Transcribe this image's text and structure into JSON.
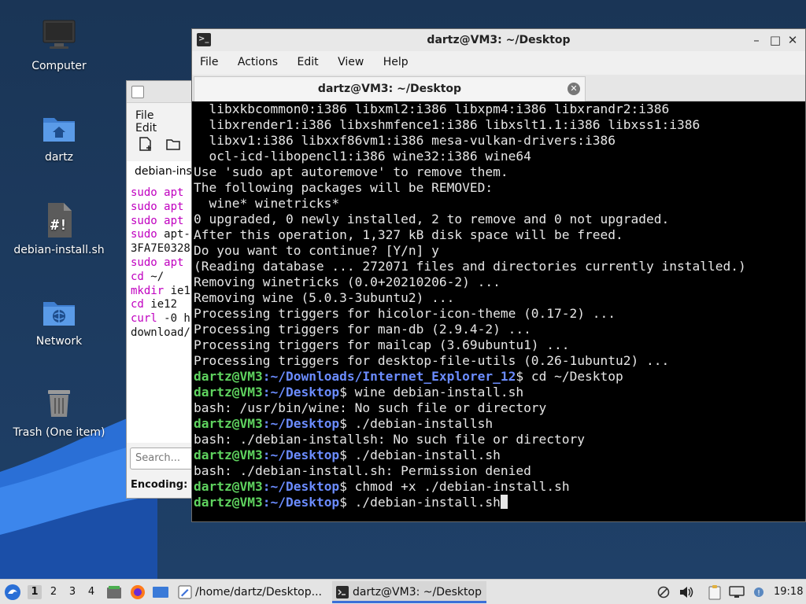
{
  "desktop": {
    "icons": [
      {
        "label": "Computer"
      },
      {
        "label": "dartz"
      },
      {
        "label": "debian-install.sh"
      },
      {
        "label": "Network"
      },
      {
        "label": "Trash (One item)"
      }
    ]
  },
  "editor": {
    "menu": [
      "File",
      "Edit"
    ],
    "tab_label": "debian-install.sh",
    "lines": [
      {
        "kw": "sudo apt",
        "rest": ""
      },
      {
        "kw": "sudo apt",
        "rest": ""
      },
      {
        "kw": "sudo apt",
        "rest": ""
      },
      {
        "kw": "sudo",
        "rest": " apt-"
      },
      {
        "kw": "",
        "rest": "3FA7E0328"
      },
      {
        "kw": "sudo apt",
        "rest": ""
      },
      {
        "kw": "cd",
        "rest": " ~/"
      },
      {
        "kw": "mkdir",
        "rest": " ie1"
      },
      {
        "kw": "cd",
        "rest": " ie12"
      },
      {
        "kw": "curl",
        "rest": " -0 h"
      },
      {
        "kw": "",
        "rest": "download/"
      }
    ],
    "search_placeholder": "Search...",
    "encoding_label": "Encoding:"
  },
  "terminal": {
    "title": "dartz@VM3: ~/Desktop",
    "menu": [
      "File",
      "Actions",
      "Edit",
      "View",
      "Help"
    ],
    "tab_label": "dartz@VM3: ~/Desktop",
    "prompt_user": "dartz@VM3",
    "lines": [
      {
        "text": "  libxkbcommon0:i386 libxml2:i386 libxpm4:i386 libxrandr2:i386"
      },
      {
        "text": "  libxrender1:i386 libxshmfence1:i386 libxslt1.1:i386 libxss1:i386"
      },
      {
        "text": "  libxv1:i386 libxxf86vm1:i386 mesa-vulkan-drivers:i386"
      },
      {
        "text": "  ocl-icd-libopencl1:i386 wine32:i386 wine64"
      },
      {
        "text": "Use 'sudo apt autoremove' to remove them."
      },
      {
        "text": "The following packages will be REMOVED:"
      },
      {
        "text": "  wine* winetricks*"
      },
      {
        "text": "0 upgraded, 0 newly installed, 2 to remove and 0 not upgraded."
      },
      {
        "text": "After this operation, 1,327 kB disk space will be freed."
      },
      {
        "text": "Do you want to continue? [Y/n] y"
      },
      {
        "text": "(Reading database ... 272071 files and directories currently installed.)"
      },
      {
        "text": "Removing winetricks (0.0+20210206-2) ..."
      },
      {
        "text": "Removing wine (5.0.3-3ubuntu2) ..."
      },
      {
        "text": "Processing triggers for hicolor-icon-theme (0.17-2) ..."
      },
      {
        "text": "Processing triggers for man-db (2.9.4-2) ..."
      },
      {
        "text": "Processing triggers for mailcap (3.69ubuntu1) ..."
      },
      {
        "text": "Processing triggers for desktop-file-utils (0.26-1ubuntu2) ..."
      },
      {
        "prompt": true,
        "path": "~/Downloads/Internet_Explorer_12",
        "cmd": " cd ~/Desktop"
      },
      {
        "prompt": true,
        "path": "~/Desktop",
        "cmd": " wine debian-install.sh"
      },
      {
        "text": "bash: /usr/bin/wine: No such file or directory"
      },
      {
        "prompt": true,
        "path": "~/Desktop",
        "cmd": " ./debian-installsh"
      },
      {
        "text": "bash: ./debian-installsh: No such file or directory"
      },
      {
        "prompt": true,
        "path": "~/Desktop",
        "cmd": " ./debian-install.sh"
      },
      {
        "text": "bash: ./debian-install.sh: Permission denied"
      },
      {
        "prompt": true,
        "path": "~/Desktop",
        "cmd": " chmod +x ./debian-install.sh"
      },
      {
        "prompt": true,
        "path": "~/Desktop",
        "cmd": " ./debian-install.sh",
        "cursor": true
      }
    ]
  },
  "taskbar": {
    "workspaces": [
      "1",
      "2",
      "3",
      "4"
    ],
    "active_workspace": "1",
    "tasks": [
      {
        "label": "/home/dartz/Desktop...",
        "icon": "text-editor-icon"
      },
      {
        "label": "dartz@VM3: ~/Desktop",
        "icon": "terminal-icon"
      }
    ],
    "clock": "19:18"
  },
  "colors": {
    "prompt_user": "#5fd35f",
    "prompt_path": "#6b8cff",
    "editor_keyword": "#c000c0",
    "desktop_bg": "#1d3a5f"
  }
}
